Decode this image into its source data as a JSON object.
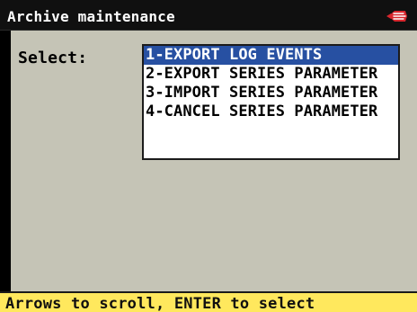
{
  "window": {
    "title": "Archive maintenance",
    "logo_icon": "brand-logo-icon"
  },
  "main": {
    "select_label": "Select:",
    "options": [
      {
        "label": "1-EXPORT LOG EVENTS",
        "selected": true
      },
      {
        "label": "2-EXPORT SERIES PARAMETER",
        "selected": false
      },
      {
        "label": "3-IMPORT SERIES PARAMETER",
        "selected": false
      },
      {
        "label": "4-CANCEL SERIES PARAMETER",
        "selected": false
      }
    ]
  },
  "statusbar": {
    "text": "Arrows to scroll, ENTER to select"
  },
  "colors": {
    "title_bg": "#101010",
    "content_bg": "#c5c4b6",
    "selection_bg": "#2750a2",
    "status_bg": "#ffe85d",
    "logo_red": "#d7262d"
  }
}
